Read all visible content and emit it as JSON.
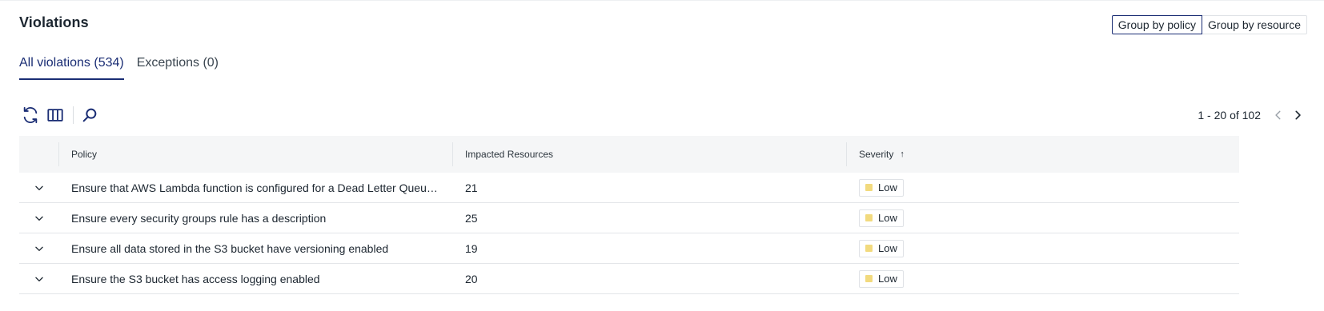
{
  "page": {
    "title": "Violations"
  },
  "group_toggle": {
    "by_policy": "Group by policy",
    "by_resource": "Group by resource"
  },
  "tabs": [
    {
      "label": "All violations (534)",
      "active": true
    },
    {
      "label": "Exceptions (0)",
      "active": false
    }
  ],
  "toolbar": {
    "icons": [
      "refresh-icon",
      "columns-icon",
      "search-icon"
    ]
  },
  "pager": {
    "text": "1 - 20 of 102"
  },
  "table": {
    "columns": [
      "Policy",
      "Impacted Resources",
      "Severity"
    ],
    "sort": {
      "column": "Severity",
      "direction": "ascending",
      "indicator": "↑"
    },
    "rows": [
      {
        "policy": "Ensure that AWS Lambda function is configured for a Dead Letter Queue(DLQ)",
        "impacted": "21",
        "severity": "Low"
      },
      {
        "policy": "Ensure every security groups rule has a description",
        "impacted": "25",
        "severity": "Low"
      },
      {
        "policy": "Ensure all data stored in the S3 bucket have versioning enabled",
        "impacted": "19",
        "severity": "Low"
      },
      {
        "policy": "Ensure the S3 bucket has access logging enabled",
        "impacted": "20",
        "severity": "Low"
      }
    ]
  },
  "colors": {
    "accent": "#1a2d74",
    "header_bg": "#f5f6f7",
    "severity_low": "#f2da7e"
  }
}
